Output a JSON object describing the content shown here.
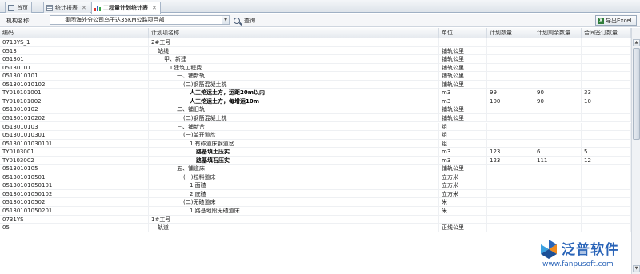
{
  "tabs": [
    {
      "label": "首页",
      "icon": "home-icon"
    },
    {
      "label": "统计报表",
      "icon": "report-icon"
    },
    {
      "label": "工程量计划统计表",
      "icon": "bar-chart-icon",
      "active": true
    }
  ],
  "toolbar": {
    "org_label": "机构名称:",
    "org_value": "集团海外分公司乌干达35KM公路项目部",
    "search_label": "查询",
    "export_label": "导出Excel"
  },
  "columns": [
    "编码",
    "计划项名称",
    "单位",
    "计划数量",
    "计划剩余数量",
    "合同签订数量"
  ],
  "rows": [
    {
      "code": "0713YS_1",
      "name": "2#工号",
      "indent": 0,
      "unit": "",
      "plan": "",
      "remain": "",
      "contract": "",
      "bold": false
    },
    {
      "code": "0513",
      "name": "站线",
      "indent": 1,
      "unit": "铺轨公里",
      "plan": "",
      "remain": "",
      "contract": "",
      "bold": false
    },
    {
      "code": "051301",
      "name": "甲、新建",
      "indent": 2,
      "unit": "铺轨公里",
      "plan": "",
      "remain": "",
      "contract": "",
      "bold": false
    },
    {
      "code": "05130101",
      "name": "Ⅰ.建筑工程费",
      "indent": 3,
      "unit": "铺轨公里",
      "plan": "",
      "remain": "",
      "contract": "",
      "bold": false
    },
    {
      "code": "0513010101",
      "name": "一、铺新轨",
      "indent": 4,
      "unit": "铺轨公里",
      "plan": "",
      "remain": "",
      "contract": "",
      "bold": false
    },
    {
      "code": "051301010102",
      "name": "(二)钢筋混凝土枕",
      "indent": 5,
      "unit": "铺轨公里",
      "plan": "",
      "remain": "",
      "contract": "",
      "bold": false
    },
    {
      "code": "TY010101001",
      "name": "人工挖运土方，运距20m以内",
      "indent": 6,
      "unit": "m3",
      "plan": "99",
      "remain": "90",
      "contract": "33",
      "bold": true
    },
    {
      "code": "TY010101002",
      "name": "人工挖运土方，每增运10m",
      "indent": 6,
      "unit": "m3",
      "plan": "100",
      "remain": "90",
      "contract": "10",
      "bold": true
    },
    {
      "code": "0513010102",
      "name": "二、铺旧轨",
      "indent": 4,
      "unit": "铺轨公里",
      "plan": "",
      "remain": "",
      "contract": "",
      "bold": false
    },
    {
      "code": "051301010202",
      "name": "(二)钢筋混凝土枕",
      "indent": 5,
      "unit": "铺轨公里",
      "plan": "",
      "remain": "",
      "contract": "",
      "bold": false
    },
    {
      "code": "0513010103",
      "name": "三、铺新岔",
      "indent": 4,
      "unit": "组",
      "plan": "",
      "remain": "",
      "contract": "",
      "bold": false
    },
    {
      "code": "051301010301",
      "name": "(一)单开道岔",
      "indent": 5,
      "unit": "组",
      "plan": "",
      "remain": "",
      "contract": "",
      "bold": false
    },
    {
      "code": "05130101030101",
      "name": "1.有砟道床钢道岔",
      "indent": 6,
      "unit": "组",
      "plan": "",
      "remain": "",
      "contract": "",
      "bold": false
    },
    {
      "code": "TY0103001",
      "name": "路基填土压实",
      "indent": 7,
      "unit": "m3",
      "plan": "123",
      "remain": "6",
      "contract": "5",
      "bold": true
    },
    {
      "code": "TY0103002",
      "name": "路基填石压实",
      "indent": 7,
      "unit": "m3",
      "plan": "123",
      "remain": "111",
      "contract": "12",
      "bold": true
    },
    {
      "code": "0513010105",
      "name": "五、铺道床",
      "indent": 4,
      "unit": "铺轨公里",
      "plan": "",
      "remain": "",
      "contract": "",
      "bold": false
    },
    {
      "code": "051301010501",
      "name": "(一)粒料道床",
      "indent": 5,
      "unit": "立方米",
      "plan": "",
      "remain": "",
      "contract": "",
      "bold": false
    },
    {
      "code": "05130101050101",
      "name": "1.面碴",
      "indent": 6,
      "unit": "立方米",
      "plan": "",
      "remain": "",
      "contract": "",
      "bold": false
    },
    {
      "code": "05130101050102",
      "name": "2.底碴",
      "indent": 6,
      "unit": "立方米",
      "plan": "",
      "remain": "",
      "contract": "",
      "bold": false
    },
    {
      "code": "051301010502",
      "name": "(二)无碴道床",
      "indent": 5,
      "unit": "米",
      "plan": "",
      "remain": "",
      "contract": "",
      "bold": false
    },
    {
      "code": "05130101050201",
      "name": "1.路基地段无碴道床",
      "indent": 6,
      "unit": "米",
      "plan": "",
      "remain": "",
      "contract": "",
      "bold": false
    },
    {
      "code": "0731YS",
      "name": "1#工号",
      "indent": 0,
      "unit": "",
      "plan": "",
      "remain": "",
      "contract": "",
      "bold": false
    },
    {
      "code": "05",
      "name": "轨道",
      "indent": 1,
      "unit": "正线公里",
      "plan": "",
      "remain": "",
      "contract": "",
      "bold": false
    }
  ],
  "watermark": {
    "brand": "泛普软件",
    "url": "www.fanpusoft.com",
    "color": "#2a64b8"
  }
}
